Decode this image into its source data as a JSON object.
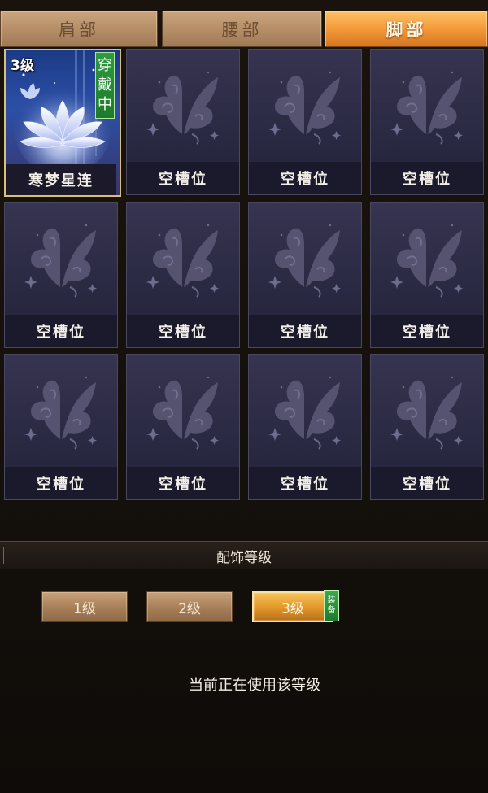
{
  "tabs": [
    {
      "label": "肩部",
      "active": false
    },
    {
      "label": "腰部",
      "active": false
    },
    {
      "label": "脚部",
      "active": true
    }
  ],
  "slots": [
    {
      "label": "寒梦星连",
      "level": "3级",
      "badge": [
        "穿",
        "戴",
        "中"
      ],
      "equipped": true,
      "icon": "lotus-icon"
    },
    {
      "label": "空槽位",
      "icon": "butterfly-icon"
    },
    {
      "label": "空槽位",
      "icon": "butterfly-icon"
    },
    {
      "label": "空槽位",
      "icon": "butterfly-icon"
    },
    {
      "label": "空槽位",
      "icon": "butterfly-icon"
    },
    {
      "label": "空槽位",
      "icon": "butterfly-icon"
    },
    {
      "label": "空槽位",
      "icon": "butterfly-icon"
    },
    {
      "label": "空槽位",
      "icon": "butterfly-icon"
    },
    {
      "label": "空槽位",
      "icon": "butterfly-icon"
    },
    {
      "label": "空槽位",
      "icon": "butterfly-icon"
    },
    {
      "label": "空槽位",
      "icon": "butterfly-icon"
    },
    {
      "label": "空槽位",
      "icon": "butterfly-icon"
    }
  ],
  "section": {
    "title": "配饰等级"
  },
  "levels": [
    {
      "label": "1级",
      "active": false
    },
    {
      "label": "2级",
      "active": false
    },
    {
      "label": "3级",
      "active": true
    }
  ],
  "equip_mark": [
    "装",
    "备"
  ],
  "status": {
    "text": "当前正在使用该等级"
  },
  "colors": {
    "active_tab": "#f39a3a",
    "slot_bg": "#2a2942",
    "badge_green": "#2e9b3f",
    "frame_gold": "#d9bf7a"
  }
}
